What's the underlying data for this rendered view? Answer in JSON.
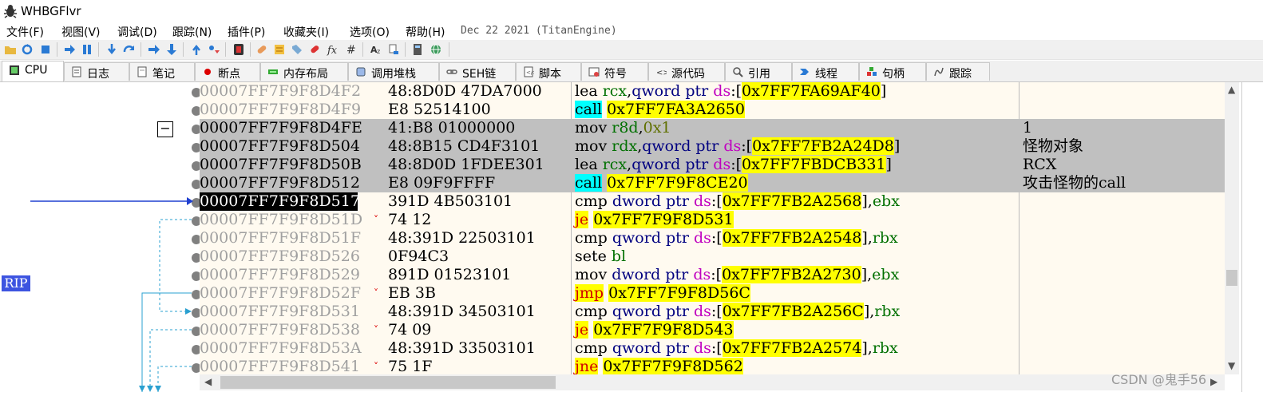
{
  "window": {
    "title": "WHBGFlvr"
  },
  "menu": {
    "items": [
      "文件(F)",
      "视图(V)",
      "调试(D)",
      "跟踪(N)",
      "插件(P)",
      "收藏夹(I)",
      "选项(O)",
      "帮助(H)"
    ],
    "build": "Dec 22 2021 (TitanEngine)"
  },
  "tabs": [
    {
      "label": "CPU",
      "icon": "cpu-icon",
      "active": true
    },
    {
      "label": "日志",
      "icon": "log-icon"
    },
    {
      "label": "笔记",
      "icon": "notes-icon"
    },
    {
      "label": "断点",
      "icon": "breakpoint-icon"
    },
    {
      "label": "内存布局",
      "icon": "memory-map-icon"
    },
    {
      "label": "调用堆栈",
      "icon": "call-stack-icon"
    },
    {
      "label": "SEH链",
      "icon": "seh-chain-icon"
    },
    {
      "label": "脚本",
      "icon": "script-icon"
    },
    {
      "label": "符号",
      "icon": "symbols-icon"
    },
    {
      "label": "源代码",
      "icon": "source-icon"
    },
    {
      "label": "引用",
      "icon": "references-icon"
    },
    {
      "label": "线程",
      "icon": "threads-icon"
    },
    {
      "label": "句柄",
      "icon": "handles-icon"
    },
    {
      "label": "跟踪",
      "icon": "trace-icon"
    }
  ],
  "gutter": {
    "rip_label": "RIP",
    "collapse_symbol": "−"
  },
  "disasm": {
    "rows": [
      {
        "addr": "00007FF7F9F8D4F2",
        "jump": "",
        "bytes": "48:8D0D 47DA7000",
        "tokens": [
          {
            "t": "lea ",
            "c": "op"
          },
          {
            "t": "rcx",
            "c": "reg"
          },
          {
            "t": ",",
            "c": "op"
          },
          {
            "t": "qword ptr ",
            "c": "kw"
          },
          {
            "t": "ds",
            "c": "seg"
          },
          {
            "t": ":[",
            "c": "op"
          },
          {
            "t": "0x7FF7FA69AF40",
            "c": "addr"
          },
          {
            "t": "]",
            "c": "op"
          }
        ],
        "comment": "",
        "sel": false,
        "cur": false
      },
      {
        "addr": "00007FF7F9F8D4F9",
        "jump": "",
        "bytes": "E8 52514100",
        "tokens": [
          {
            "t": "call",
            "c": "call"
          },
          {
            "t": " ",
            "c": "op"
          },
          {
            "t": "0x7FF7FA3A2650",
            "c": "jmpt"
          }
        ],
        "comment": "",
        "sel": false,
        "cur": false
      },
      {
        "addr": "00007FF7F9F8D4FE",
        "jump": "",
        "bytes": "41:B8 01000000",
        "tokens": [
          {
            "t": "mov ",
            "c": "op"
          },
          {
            "t": "r8d",
            "c": "reg"
          },
          {
            "t": ",",
            "c": "op"
          },
          {
            "t": "0x1",
            "c": "imm"
          }
        ],
        "comment": "1",
        "sel": true,
        "cur": false
      },
      {
        "addr": "00007FF7F9F8D504",
        "jump": "",
        "bytes": "48:8B15 CD4F3101",
        "tokens": [
          {
            "t": "mov ",
            "c": "op"
          },
          {
            "t": "rdx",
            "c": "reg"
          },
          {
            "t": ",",
            "c": "op"
          },
          {
            "t": "qword ptr ",
            "c": "kw"
          },
          {
            "t": "ds",
            "c": "seg"
          },
          {
            "t": ":[",
            "c": "op"
          },
          {
            "t": "0x7FF7FB2A24D8",
            "c": "addr"
          },
          {
            "t": "]",
            "c": "op"
          }
        ],
        "comment": "怪物对象",
        "sel": true,
        "cur": false
      },
      {
        "addr": "00007FF7F9F8D50B",
        "jump": "",
        "bytes": "48:8D0D 1FDEE301",
        "tokens": [
          {
            "t": "lea ",
            "c": "op"
          },
          {
            "t": "rcx",
            "c": "reg"
          },
          {
            "t": ",",
            "c": "op"
          },
          {
            "t": "qword ptr ",
            "c": "kw"
          },
          {
            "t": "ds",
            "c": "seg"
          },
          {
            "t": ":[",
            "c": "op"
          },
          {
            "t": "0x7FF7FBDCB331",
            "c": "addr"
          },
          {
            "t": "]",
            "c": "op"
          }
        ],
        "comment": "RCX",
        "sel": true,
        "cur": false
      },
      {
        "addr": "00007FF7F9F8D512",
        "jump": "",
        "bytes": "E8 09F9FFFF",
        "tokens": [
          {
            "t": "call",
            "c": "call"
          },
          {
            "t": " ",
            "c": "op"
          },
          {
            "t": "0x7FF7F9F8CE20",
            "c": "jmpt"
          }
        ],
        "comment": "攻击怪物的call",
        "sel": true,
        "cur": false
      },
      {
        "addr": "00007FF7F9F8D517",
        "jump": "",
        "bytes": "391D 4B503101",
        "tokens": [
          {
            "t": "cmp ",
            "c": "op"
          },
          {
            "t": "dword ptr ",
            "c": "kw"
          },
          {
            "t": "ds",
            "c": "seg"
          },
          {
            "t": ":[",
            "c": "op"
          },
          {
            "t": "0x7FF7FB2A2568",
            "c": "addr"
          },
          {
            "t": "],",
            "c": "op"
          },
          {
            "t": "ebx",
            "c": "reg"
          }
        ],
        "comment": "",
        "sel": false,
        "cur": true
      },
      {
        "addr": "00007FF7F9F8D51D",
        "jump": "˅",
        "bytes": "74 12",
        "tokens": [
          {
            "t": "je",
            "c": "jmp"
          },
          {
            "t": " ",
            "c": "op"
          },
          {
            "t": "0x7FF7F9F8D531",
            "c": "jmpt"
          }
        ],
        "comment": "",
        "sel": false,
        "cur": false
      },
      {
        "addr": "00007FF7F9F8D51F",
        "jump": "",
        "bytes": "48:391D 22503101",
        "tokens": [
          {
            "t": "cmp ",
            "c": "op"
          },
          {
            "t": "qword ptr ",
            "c": "kw"
          },
          {
            "t": "ds",
            "c": "seg"
          },
          {
            "t": ":[",
            "c": "op"
          },
          {
            "t": "0x7FF7FB2A2548",
            "c": "addr"
          },
          {
            "t": "],",
            "c": "op"
          },
          {
            "t": "rbx",
            "c": "reg"
          }
        ],
        "comment": "",
        "sel": false,
        "cur": false
      },
      {
        "addr": "00007FF7F9F8D526",
        "jump": "",
        "bytes": "0F94C3",
        "tokens": [
          {
            "t": "sete ",
            "c": "op"
          },
          {
            "t": "bl",
            "c": "reg"
          }
        ],
        "comment": "",
        "sel": false,
        "cur": false
      },
      {
        "addr": "00007FF7F9F8D529",
        "jump": "",
        "bytes": "891D 01523101",
        "tokens": [
          {
            "t": "mov ",
            "c": "op"
          },
          {
            "t": "dword ptr ",
            "c": "kw"
          },
          {
            "t": "ds",
            "c": "seg"
          },
          {
            "t": ":[",
            "c": "op"
          },
          {
            "t": "0x7FF7FB2A2730",
            "c": "addr"
          },
          {
            "t": "],",
            "c": "op"
          },
          {
            "t": "ebx",
            "c": "reg"
          }
        ],
        "comment": "",
        "sel": false,
        "cur": false
      },
      {
        "addr": "00007FF7F9F8D52F",
        "jump": "˅",
        "bytes": "EB 3B",
        "tokens": [
          {
            "t": "jmp",
            "c": "jmp"
          },
          {
            "t": " ",
            "c": "op"
          },
          {
            "t": "0x7FF7F9F8D56C",
            "c": "jmpt"
          }
        ],
        "comment": "",
        "sel": false,
        "cur": false
      },
      {
        "addr": "00007FF7F9F8D531",
        "jump": "",
        "bytes": "48:391D 34503101",
        "tokens": [
          {
            "t": "cmp ",
            "c": "op"
          },
          {
            "t": "qword ptr ",
            "c": "kw"
          },
          {
            "t": "ds",
            "c": "seg"
          },
          {
            "t": ":[",
            "c": "op"
          },
          {
            "t": "0x7FF7FB2A256C",
            "c": "addr"
          },
          {
            "t": "],",
            "c": "op"
          },
          {
            "t": "rbx",
            "c": "reg"
          }
        ],
        "comment": "",
        "sel": false,
        "cur": false
      },
      {
        "addr": "00007FF7F9F8D538",
        "jump": "˅",
        "bytes": "74 09",
        "tokens": [
          {
            "t": "je",
            "c": "jmp"
          },
          {
            "t": " ",
            "c": "op"
          },
          {
            "t": "0x7FF7F9F8D543",
            "c": "jmpt"
          }
        ],
        "comment": "",
        "sel": false,
        "cur": false
      },
      {
        "addr": "00007FF7F9F8D53A",
        "jump": "",
        "bytes": "48:391D 33503101",
        "tokens": [
          {
            "t": "cmp ",
            "c": "op"
          },
          {
            "t": "qword ptr ",
            "c": "kw"
          },
          {
            "t": "ds",
            "c": "seg"
          },
          {
            "t": ":[",
            "c": "op"
          },
          {
            "t": "0x7FF7FB2A2574",
            "c": "addr"
          },
          {
            "t": "],",
            "c": "op"
          },
          {
            "t": "rbx",
            "c": "reg"
          }
        ],
        "comment": "",
        "sel": false,
        "cur": false
      },
      {
        "addr": "00007FF7F9F8D541",
        "jump": "˅",
        "bytes": "75 1F",
        "tokens": [
          {
            "t": "jne",
            "c": "jmp"
          },
          {
            "t": " ",
            "c": "op"
          },
          {
            "t": "0x7FF7F9F8D562",
            "c": "jmpt"
          }
        ],
        "comment": "",
        "sel": false,
        "cur": false
      }
    ]
  },
  "watermark": "CSDN @鬼手56",
  "colors": {
    "rip_bg": "#3d54e0",
    "selection": "#c0c0c0",
    "address_highlight": "#ffff00",
    "call_highlight": "#00ffff",
    "background": "#fffaf0"
  }
}
